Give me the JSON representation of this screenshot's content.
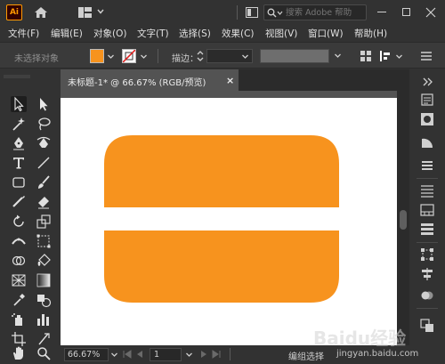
{
  "app": {
    "logo_text": "Ai",
    "accent": "#ff9a00"
  },
  "titlebar": {
    "search_placeholder": "搜索 Adobe 帮助"
  },
  "menu": [
    "文件(F)",
    "编辑(E)",
    "对象(O)",
    "文字(T)",
    "选择(S)",
    "效果(C)",
    "视图(V)",
    "窗口(W)",
    "帮助(H)"
  ],
  "control_bar": {
    "selection_status": "未选择对象",
    "fill_color": "#f7931e",
    "stroke_label": "描边：",
    "stroke_value": ""
  },
  "document": {
    "tab_title": "未标题-1* @ 66.67% (RGB/预览)",
    "close_glyph": "×",
    "artwork_color": "#f7931e"
  },
  "status": {
    "zoom": "66.67%",
    "page": "1",
    "tool_status": "编组选择"
  },
  "watermark": {
    "brand": "Baidu经验",
    "url": "jingyan.baidu.com"
  }
}
